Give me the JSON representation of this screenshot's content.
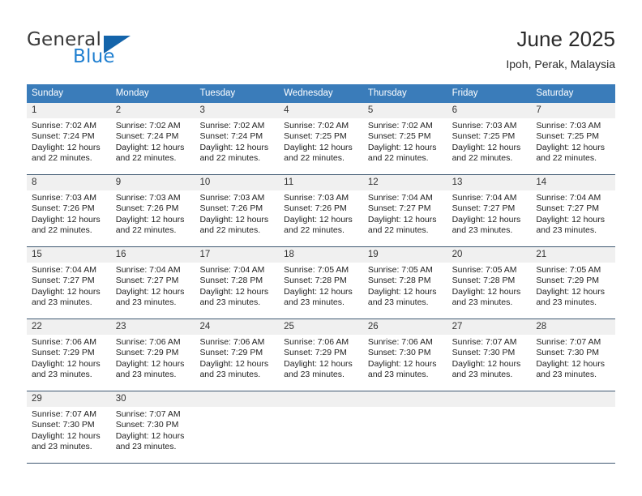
{
  "brand": {
    "name_top": "General",
    "name_bottom": "Blue",
    "triangle_color": "#1464aa",
    "blue_color": "#1f7fd0"
  },
  "header": {
    "title": "June 2025",
    "subtitle": "Ipoh, Perak, Malaysia"
  },
  "theme": {
    "header_background": "#3a7cba",
    "header_text": "#ffffff",
    "daynum_background": "#f0f0f0",
    "rule_color": "#3f5871"
  },
  "weekdays": [
    "Sunday",
    "Monday",
    "Tuesday",
    "Wednesday",
    "Thursday",
    "Friday",
    "Saturday"
  ],
  "weeks": [
    {
      "days": [
        {
          "num": "1",
          "sunrise": "Sunrise: 7:02 AM",
          "sunset": "Sunset: 7:24 PM",
          "daylight1": "Daylight: 12 hours",
          "daylight2": "and 22 minutes."
        },
        {
          "num": "2",
          "sunrise": "Sunrise: 7:02 AM",
          "sunset": "Sunset: 7:24 PM",
          "daylight1": "Daylight: 12 hours",
          "daylight2": "and 22 minutes."
        },
        {
          "num": "3",
          "sunrise": "Sunrise: 7:02 AM",
          "sunset": "Sunset: 7:24 PM",
          "daylight1": "Daylight: 12 hours",
          "daylight2": "and 22 minutes."
        },
        {
          "num": "4",
          "sunrise": "Sunrise: 7:02 AM",
          "sunset": "Sunset: 7:25 PM",
          "daylight1": "Daylight: 12 hours",
          "daylight2": "and 22 minutes."
        },
        {
          "num": "5",
          "sunrise": "Sunrise: 7:02 AM",
          "sunset": "Sunset: 7:25 PM",
          "daylight1": "Daylight: 12 hours",
          "daylight2": "and 22 minutes."
        },
        {
          "num": "6",
          "sunrise": "Sunrise: 7:03 AM",
          "sunset": "Sunset: 7:25 PM",
          "daylight1": "Daylight: 12 hours",
          "daylight2": "and 22 minutes."
        },
        {
          "num": "7",
          "sunrise": "Sunrise: 7:03 AM",
          "sunset": "Sunset: 7:25 PM",
          "daylight1": "Daylight: 12 hours",
          "daylight2": "and 22 minutes."
        }
      ]
    },
    {
      "days": [
        {
          "num": "8",
          "sunrise": "Sunrise: 7:03 AM",
          "sunset": "Sunset: 7:26 PM",
          "daylight1": "Daylight: 12 hours",
          "daylight2": "and 22 minutes."
        },
        {
          "num": "9",
          "sunrise": "Sunrise: 7:03 AM",
          "sunset": "Sunset: 7:26 PM",
          "daylight1": "Daylight: 12 hours",
          "daylight2": "and 22 minutes."
        },
        {
          "num": "10",
          "sunrise": "Sunrise: 7:03 AM",
          "sunset": "Sunset: 7:26 PM",
          "daylight1": "Daylight: 12 hours",
          "daylight2": "and 22 minutes."
        },
        {
          "num": "11",
          "sunrise": "Sunrise: 7:03 AM",
          "sunset": "Sunset: 7:26 PM",
          "daylight1": "Daylight: 12 hours",
          "daylight2": "and 22 minutes."
        },
        {
          "num": "12",
          "sunrise": "Sunrise: 7:04 AM",
          "sunset": "Sunset: 7:27 PM",
          "daylight1": "Daylight: 12 hours",
          "daylight2": "and 22 minutes."
        },
        {
          "num": "13",
          "sunrise": "Sunrise: 7:04 AM",
          "sunset": "Sunset: 7:27 PM",
          "daylight1": "Daylight: 12 hours",
          "daylight2": "and 23 minutes."
        },
        {
          "num": "14",
          "sunrise": "Sunrise: 7:04 AM",
          "sunset": "Sunset: 7:27 PM",
          "daylight1": "Daylight: 12 hours",
          "daylight2": "and 23 minutes."
        }
      ]
    },
    {
      "days": [
        {
          "num": "15",
          "sunrise": "Sunrise: 7:04 AM",
          "sunset": "Sunset: 7:27 PM",
          "daylight1": "Daylight: 12 hours",
          "daylight2": "and 23 minutes."
        },
        {
          "num": "16",
          "sunrise": "Sunrise: 7:04 AM",
          "sunset": "Sunset: 7:27 PM",
          "daylight1": "Daylight: 12 hours",
          "daylight2": "and 23 minutes."
        },
        {
          "num": "17",
          "sunrise": "Sunrise: 7:04 AM",
          "sunset": "Sunset: 7:28 PM",
          "daylight1": "Daylight: 12 hours",
          "daylight2": "and 23 minutes."
        },
        {
          "num": "18",
          "sunrise": "Sunrise: 7:05 AM",
          "sunset": "Sunset: 7:28 PM",
          "daylight1": "Daylight: 12 hours",
          "daylight2": "and 23 minutes."
        },
        {
          "num": "19",
          "sunrise": "Sunrise: 7:05 AM",
          "sunset": "Sunset: 7:28 PM",
          "daylight1": "Daylight: 12 hours",
          "daylight2": "and 23 minutes."
        },
        {
          "num": "20",
          "sunrise": "Sunrise: 7:05 AM",
          "sunset": "Sunset: 7:28 PM",
          "daylight1": "Daylight: 12 hours",
          "daylight2": "and 23 minutes."
        },
        {
          "num": "21",
          "sunrise": "Sunrise: 7:05 AM",
          "sunset": "Sunset: 7:29 PM",
          "daylight1": "Daylight: 12 hours",
          "daylight2": "and 23 minutes."
        }
      ]
    },
    {
      "days": [
        {
          "num": "22",
          "sunrise": "Sunrise: 7:06 AM",
          "sunset": "Sunset: 7:29 PM",
          "daylight1": "Daylight: 12 hours",
          "daylight2": "and 23 minutes."
        },
        {
          "num": "23",
          "sunrise": "Sunrise: 7:06 AM",
          "sunset": "Sunset: 7:29 PM",
          "daylight1": "Daylight: 12 hours",
          "daylight2": "and 23 minutes."
        },
        {
          "num": "24",
          "sunrise": "Sunrise: 7:06 AM",
          "sunset": "Sunset: 7:29 PM",
          "daylight1": "Daylight: 12 hours",
          "daylight2": "and 23 minutes."
        },
        {
          "num": "25",
          "sunrise": "Sunrise: 7:06 AM",
          "sunset": "Sunset: 7:29 PM",
          "daylight1": "Daylight: 12 hours",
          "daylight2": "and 23 minutes."
        },
        {
          "num": "26",
          "sunrise": "Sunrise: 7:06 AM",
          "sunset": "Sunset: 7:30 PM",
          "daylight1": "Daylight: 12 hours",
          "daylight2": "and 23 minutes."
        },
        {
          "num": "27",
          "sunrise": "Sunrise: 7:07 AM",
          "sunset": "Sunset: 7:30 PM",
          "daylight1": "Daylight: 12 hours",
          "daylight2": "and 23 minutes."
        },
        {
          "num": "28",
          "sunrise": "Sunrise: 7:07 AM",
          "sunset": "Sunset: 7:30 PM",
          "daylight1": "Daylight: 12 hours",
          "daylight2": "and 23 minutes."
        }
      ]
    },
    {
      "days": [
        {
          "num": "29",
          "sunrise": "Sunrise: 7:07 AM",
          "sunset": "Sunset: 7:30 PM",
          "daylight1": "Daylight: 12 hours",
          "daylight2": "and 23 minutes."
        },
        {
          "num": "30",
          "sunrise": "Sunrise: 7:07 AM",
          "sunset": "Sunset: 7:30 PM",
          "daylight1": "Daylight: 12 hours",
          "daylight2": "and 23 minutes."
        },
        {
          "num": "",
          "sunrise": "",
          "sunset": "",
          "daylight1": "",
          "daylight2": ""
        },
        {
          "num": "",
          "sunrise": "",
          "sunset": "",
          "daylight1": "",
          "daylight2": ""
        },
        {
          "num": "",
          "sunrise": "",
          "sunset": "",
          "daylight1": "",
          "daylight2": ""
        },
        {
          "num": "",
          "sunrise": "",
          "sunset": "",
          "daylight1": "",
          "daylight2": ""
        },
        {
          "num": "",
          "sunrise": "",
          "sunset": "",
          "daylight1": "",
          "daylight2": ""
        }
      ]
    }
  ]
}
